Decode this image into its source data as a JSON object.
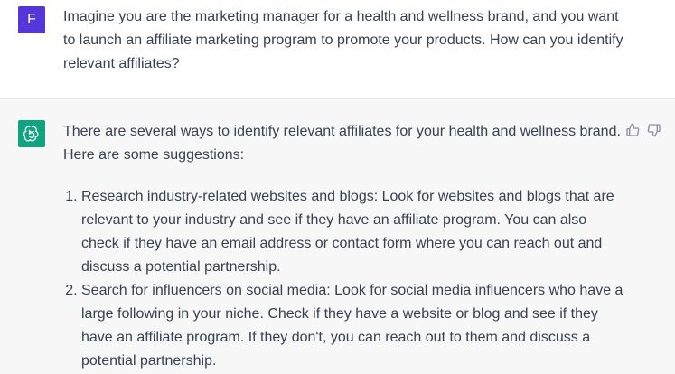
{
  "user_message": {
    "avatar_letter": "F",
    "text": "Imagine you are the marketing manager for a health and wellness brand, and you want to launch an affiliate marketing program to promote your products. How can you identify relevant affiliates?"
  },
  "assistant_message": {
    "intro": "There are several ways to identify relevant affiliates for your health and wellness brand. Here are some suggestions:",
    "list_items": [
      "Research industry-related websites and blogs: Look for websites and blogs that are relevant to your industry and see if they have an affiliate program. You can also check if they have an email address or contact form where you can reach out and discuss a potential partnership.",
      "Search for influencers on social media: Look for social media influencers who have a large following in your niche. Check if they have a website or blog and see if they have an affiliate program. If they don't, you can reach out to them and discuss a potential partnership."
    ]
  },
  "icons": {
    "user_avatar": "user-avatar",
    "assistant_avatar": "openai-logo-icon",
    "thumbs_up": "thumbs-up-icon",
    "thumbs_down": "thumbs-down-icon"
  },
  "colors": {
    "user_avatar_bg": "#5436da",
    "assistant_avatar_bg": "#10a37f",
    "assistant_block_bg": "#f7f7f8"
  }
}
